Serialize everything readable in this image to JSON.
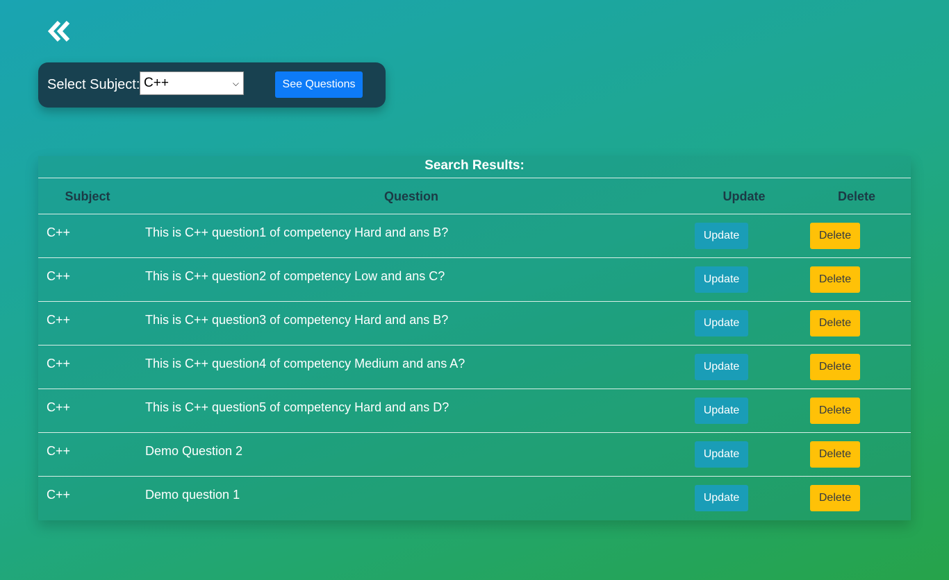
{
  "back": {
    "icon": "double-chevron-left-icon"
  },
  "subject_bar": {
    "label": "Select Subject:",
    "selected": "C++",
    "button_label": "See Questions"
  },
  "results": {
    "title": "Search Results:",
    "columns": {
      "subject": "Subject",
      "question": "Question",
      "update": "Update",
      "delete": "Delete"
    },
    "rows": [
      {
        "subject": "C++",
        "question": "This is C++ question1 of competency Hard and ans B?",
        "update": "Update",
        "delete": "Delete"
      },
      {
        "subject": "C++",
        "question": "This is C++ question2 of competency Low and ans C?",
        "update": "Update",
        "delete": "Delete"
      },
      {
        "subject": "C++",
        "question": "This is C++ question3 of competency Hard and ans B?",
        "update": "Update",
        "delete": "Delete"
      },
      {
        "subject": "C++",
        "question": "This is C++ question4 of competency Medium and ans A?",
        "update": "Update",
        "delete": "Delete"
      },
      {
        "subject": "C++",
        "question": "This is C++ question5 of competency Hard and ans D?",
        "update": "Update",
        "delete": "Delete"
      },
      {
        "subject": "C++",
        "question": "Demo Question 2",
        "update": "Update",
        "delete": "Delete"
      },
      {
        "subject": "C++",
        "question": "Demo question 1",
        "update": "Update",
        "delete": "Delete"
      }
    ]
  },
  "colors": {
    "update_button": "#1a9db7",
    "delete_button": "#ffc107",
    "see_questions_button": "#0d7bf7",
    "subject_bar": "#184150"
  }
}
